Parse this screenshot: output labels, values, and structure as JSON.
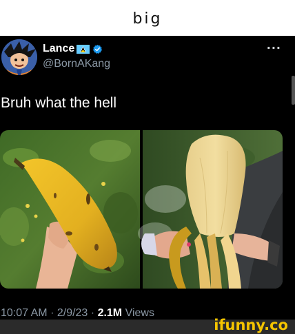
{
  "top_caption": "big",
  "tweet": {
    "display_name": "Lance",
    "handle": "@BornAKang",
    "more_label": "···",
    "text": "Bruh what the hell",
    "time": "10:07 AM",
    "separator": "·",
    "date": "2/9/23",
    "views_count": "2.1M",
    "views_label": "Views"
  },
  "watermark": "ifunny.co",
  "colors": {
    "background": "#000000",
    "secondary_text": "#8b98a5",
    "verified": "#1d9bf0",
    "watermark": "#f5c400"
  },
  "icons": [
    "saint-lucia-flag-icon",
    "verified-badge-icon",
    "more-options-icon"
  ]
}
